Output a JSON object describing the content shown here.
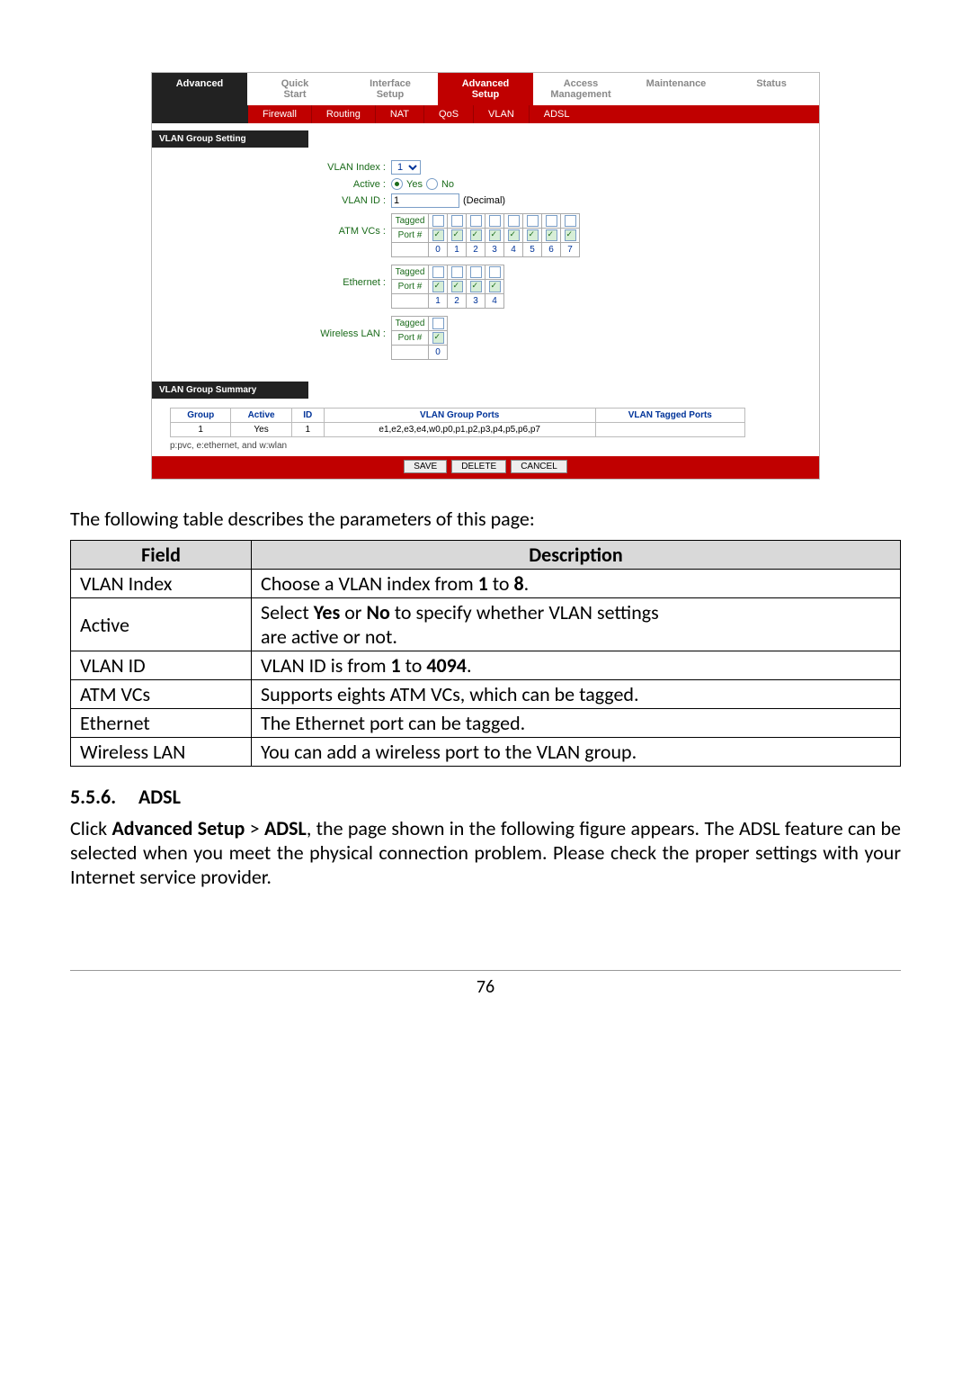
{
  "router": {
    "sidebar_title": "Advanced",
    "top_tabs": {
      "quick_start": "Quick\nStart",
      "interface_setup": "Interface\nSetup",
      "advanced_setup": "Advanced\nSetup",
      "access_mgmt": "Access\nManagement",
      "maintenance": "Maintenance",
      "status": "Status"
    },
    "sub_tabs": {
      "firewall": "Firewall",
      "routing": "Routing",
      "nat": "NAT",
      "qos": "QoS",
      "vlan": "VLAN",
      "adsl": "ADSL"
    },
    "section_setting": "VLAN Group Setting",
    "section_summary": "VLAN Group Summary",
    "labels": {
      "vlan_index": "VLAN Index :",
      "active": "Active :",
      "vlan_id": "VLAN ID :",
      "atm_vcs": "ATM VCs :",
      "ethernet": "Ethernet :",
      "wlan": "Wireless LAN :",
      "yes": "Yes",
      "no": "No",
      "decimal": "(Decimal)",
      "tagged": "Tagged",
      "port": "Port #"
    },
    "vlan_index_value": "1",
    "vlan_id_value": "1",
    "summary_headers": {
      "group": "Group",
      "active": "Active",
      "id": "ID",
      "ports": "VLAN Group Ports",
      "tagged": "VLAN Tagged Ports"
    },
    "summary_row": {
      "group": "1",
      "active": "Yes",
      "id": "1",
      "ports": "e1,e2,e3,e4,w0,p0,p1,p2,p3,p4,p5,p6,p7",
      "tagged": ""
    },
    "legend": "p:pvc, e:ethernet, and w:wlan",
    "buttons": {
      "save": "SAVE",
      "delete": "DELETE",
      "cancel": "CANCEL"
    }
  },
  "intro_text": "The following table describes the parameters of this page:",
  "param_table": {
    "head_field": "Field",
    "head_desc": "Description",
    "rows": [
      {
        "field": "VLAN Index",
        "desc_pre": "Choose a VLAN index from ",
        "b1": "1",
        "mid": " to ",
        "b2": "8",
        "post": "."
      },
      {
        "field": "Active",
        "desc_multi": true,
        "line1_pre": "Select ",
        "line1_b1": "Yes",
        "line1_mid": " or ",
        "line1_b2": "No",
        "line1_post": " to specify whether VLAN settings",
        "line2": "are active or not."
      },
      {
        "field": "VLAN ID",
        "desc_pre": "VLAN ID is from ",
        "b1": "1",
        "mid": " to ",
        "b2": "4094",
        "post": "."
      },
      {
        "field": "ATM VCs",
        "plain": "Supports eights ATM VCs, which can be tagged."
      },
      {
        "field": "Ethernet",
        "plain": "The Ethernet port can be tagged."
      },
      {
        "field": "Wireless LAN",
        "plain": "You can add a wireless port to the VLAN group."
      }
    ]
  },
  "heading": {
    "num": "5.5.6.",
    "title": "ADSL"
  },
  "paragraph": {
    "pre": "Click ",
    "b1": "Advanced Setup",
    "mid1": " > ",
    "b2": "ADSL",
    "post": ", the page shown in the following figure appears. The ADSL feature can be selected when you meet the physical connection problem. Please check the proper settings with your Internet service provider."
  },
  "chart_data": {
    "type": "table",
    "title": "VLAN Group Setting form values",
    "vlan_index": 1,
    "active": "Yes",
    "vlan_id": 1,
    "atm_vcs": {
      "ports": [
        0,
        1,
        2,
        3,
        4,
        5,
        6,
        7
      ],
      "tagged": [
        false,
        false,
        false,
        false,
        false,
        false,
        false,
        false
      ],
      "member": [
        true,
        true,
        true,
        true,
        true,
        true,
        true,
        true
      ]
    },
    "ethernet": {
      "ports": [
        1,
        2,
        3,
        4
      ],
      "tagged": [
        false,
        false,
        false,
        false
      ],
      "member": [
        true,
        true,
        true,
        true
      ]
    },
    "wireless_lan": {
      "ports": [
        0
      ],
      "tagged": [
        false
      ],
      "member": [
        true
      ]
    },
    "summary": {
      "headers": [
        "Group",
        "Active",
        "ID",
        "VLAN Group Ports",
        "VLAN Tagged Ports"
      ],
      "rows": [
        [
          1,
          "Yes",
          1,
          "e1,e2,e3,e4,w0,p0,p1,p2,p3,p4,p5,p6,p7",
          ""
        ]
      ]
    }
  },
  "page_number": "76"
}
